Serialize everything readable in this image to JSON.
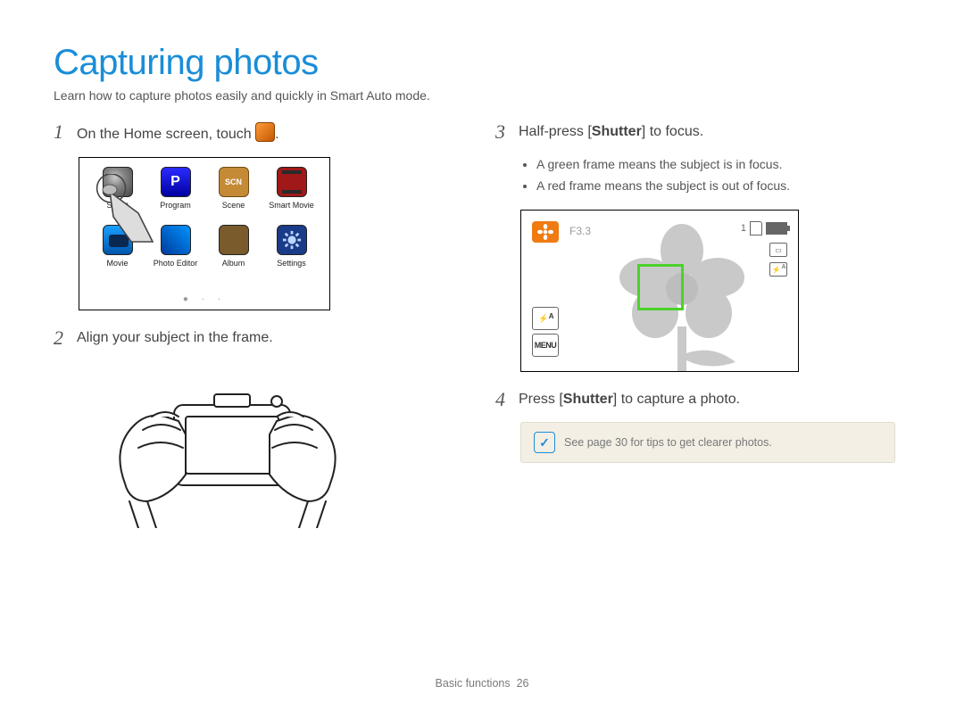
{
  "title": "Capturing photos",
  "subtitle": "Learn how to capture photos easily and quickly in Smart Auto mode.",
  "steps": {
    "s1": {
      "num": "1",
      "before": "On the Home screen, touch ",
      "after": "."
    },
    "s2": {
      "num": "2",
      "text": "Align your subject in the frame."
    },
    "s3": {
      "num": "3",
      "before": "Half-press [",
      "bold": "Shutter",
      "after": "] to focus."
    },
    "s4": {
      "num": "4",
      "before": "Press [",
      "bold": "Shutter",
      "after": "] to capture a photo."
    }
  },
  "focus_bullets": {
    "green": "A green frame means the subject is in focus.",
    "red": "A red frame means the subject is out of focus."
  },
  "home_apps": {
    "a1": "Smart",
    "a2": "Program",
    "a2_letter": "P",
    "a3": "Scene",
    "a3_code": "SCN",
    "a4": "Smart Movie",
    "a5": "Movie",
    "a6": "Photo Editor",
    "a7": "Album",
    "a8": "Settings"
  },
  "page_dots": "●  ·  ·",
  "viewfinder": {
    "fnumber": "F3.3",
    "shot_count": "1",
    "menu": "MENU",
    "flash_glyph": "⚡",
    "aspect_glyph": "▭"
  },
  "note": {
    "icon_glyph": "✓",
    "text": "See page 30 for tips to get clearer photos."
  },
  "footer": {
    "section": "Basic functions",
    "page": "26"
  }
}
